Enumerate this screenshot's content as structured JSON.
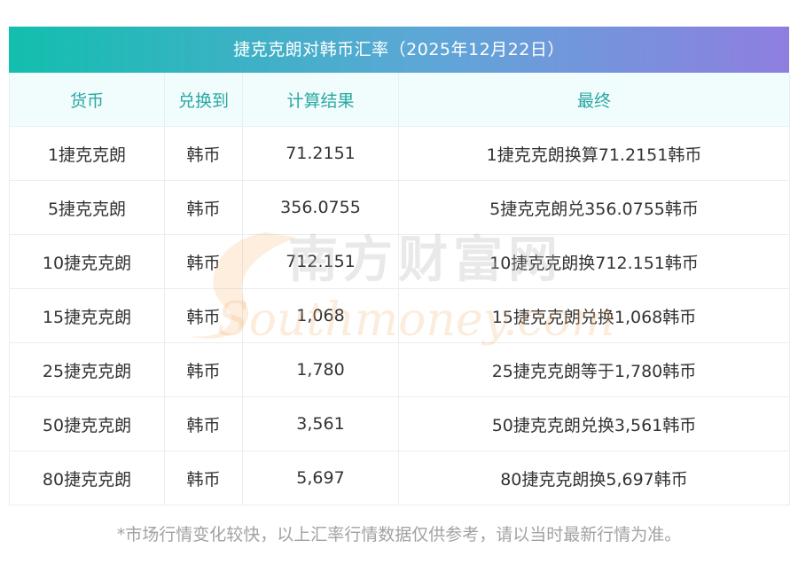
{
  "title": "捷克克朗对韩币汇率（2025年12月22日）",
  "table": {
    "headers": [
      "货币",
      "兑换到",
      "计算结果",
      "最终"
    ],
    "rows": [
      [
        "1捷克克朗",
        "韩币",
        "71.2151",
        "1捷克克朗换算71.2151韩币"
      ],
      [
        "5捷克克朗",
        "韩币",
        "356.0755",
        "5捷克克朗兑356.0755韩币"
      ],
      [
        "10捷克克朗",
        "韩币",
        "712.151",
        "10捷克克朗换712.151韩币"
      ],
      [
        "15捷克克朗",
        "韩币",
        "1,068",
        "15捷克克朗兑换1,068韩币"
      ],
      [
        "25捷克克朗",
        "韩币",
        "1,780",
        "25捷克克朗等于1,780韩币"
      ],
      [
        "50捷克克朗",
        "韩币",
        "3,561",
        "50捷克克朗兑换3,561韩币"
      ],
      [
        "80捷克克朗",
        "韩币",
        "5,697",
        "80捷克克朗换5,697韩币"
      ]
    ]
  },
  "watermark": {
    "cn_text": "南方财富网",
    "en_text": "Southmoney.com"
  },
  "footnote": "*市场行情变化较快，以上汇率行情数据仅供参考，请以当时最新行情为准。",
  "colors": {
    "title_gradient_start": "#12bfae",
    "title_gradient_end": "#8f7ee0",
    "header_bg": "#f1fcfd",
    "header_text": "#2aa8a2",
    "body_text": "#333333",
    "footnote_text": "#a2a2a2",
    "watermark_orange": "#f7b36b"
  }
}
